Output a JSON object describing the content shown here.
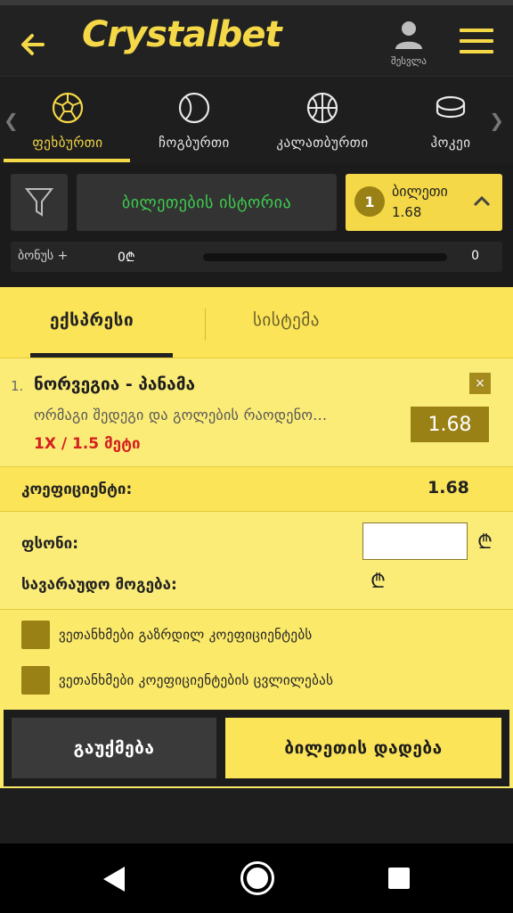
{
  "header": {
    "logo_part1": "Crystal",
    "logo_part2": "bet",
    "account_label": "შესვლა"
  },
  "sports": {
    "items": [
      {
        "name": "ფეხბურთი",
        "icon": "soccer-ball-icon",
        "active": true
      },
      {
        "name": "ჩოგბურთი",
        "icon": "tennis-ball-icon",
        "active": false
      },
      {
        "name": "კალათბურთი",
        "icon": "basketball-icon",
        "active": false
      },
      {
        "name": "ჰოკეი",
        "icon": "hockey-puck-icon",
        "active": false
      }
    ]
  },
  "toolbar": {
    "history_label": "ბილეთების ისტორია",
    "ticket_count": "1",
    "ticket_label": "ბილეთი",
    "ticket_odds": "1.68"
  },
  "bonus": {
    "label": "ბონუს +",
    "value": "0₾",
    "max": "0"
  },
  "slip": {
    "tabs": [
      "ექსპრესი",
      "სისტემა"
    ],
    "bet": {
      "number": "1.",
      "teams": "ნორვეგია - პანამა",
      "market": "ორმაგი შედეგი და გოლების რაოდენო...",
      "pick": "1X / 1.5 მეტი",
      "odds": "1.68",
      "close": "×"
    },
    "coef_label": "კოეფიციენტი:",
    "coef_value": "1.68",
    "stake_label": "ფსონი:",
    "stake_value": "",
    "currency": "₾",
    "win_label": "სავარაუდო მოგება:",
    "options": [
      "ვეთანხმები გაზრდილ კოეფიციენტებს",
      "ვეთანხმები კოეფიციენტების ცვლილებას"
    ],
    "cancel_label": "გაუქმება",
    "place_label": "ბილეთის დადება"
  },
  "colors": {
    "accent": "#f5d847",
    "panel": "#fbe96a",
    "dark": "#1c1c1c",
    "odds_bg": "#9a8116",
    "pick_red": "#d42020",
    "history_green": "#3ccf4e"
  }
}
